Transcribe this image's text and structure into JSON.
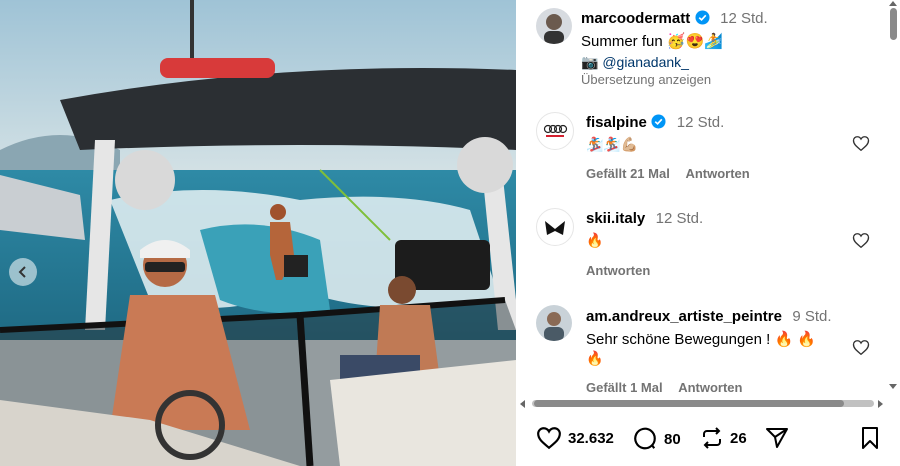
{
  "post": {
    "author": "marcoodermatt",
    "time": "12 Std.",
    "caption": "Summer fun 🥳😍🏄",
    "credit": "📷 @gianadank_",
    "translate": "Übersetzung anzeigen"
  },
  "comments": [
    {
      "user": "fisalpine",
      "verified": true,
      "time": "12 Std.",
      "text": "🏂🏂💪🏼",
      "likes": "Gefällt 21 Mal",
      "reply": "Antworten"
    },
    {
      "user": "skii.italy",
      "verified": false,
      "time": "12 Std.",
      "text": "🔥",
      "likes": "",
      "reply": "Antworten"
    },
    {
      "user": "am.andreux_artiste_peintre",
      "verified": false,
      "time": "9 Std.",
      "text": "Sehr schöne Bewegungen ! 🔥 🔥",
      "text2": "🔥",
      "likes": "Gefällt 1 Mal",
      "reply": "Antworten"
    }
  ],
  "actions": {
    "likes": "32.632",
    "comments": "80",
    "reposts": "26"
  },
  "colors": {
    "verified": "#0095f6",
    "muted": "#737373"
  },
  "icons": [
    "heart-icon",
    "comment-icon",
    "repost-icon",
    "share-icon",
    "bookmark-icon",
    "chevron-left-icon",
    "verified-icon"
  ]
}
